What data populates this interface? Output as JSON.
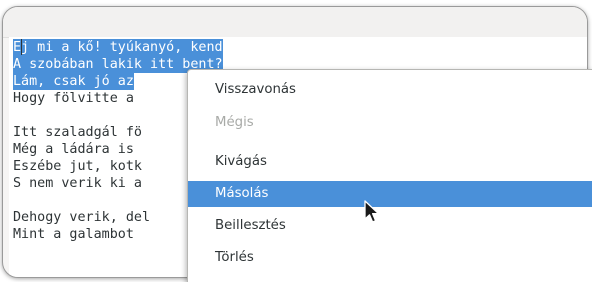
{
  "editor": {
    "lines": [
      {
        "text": "Ej mi a kő! tyúkanyó, kend",
        "selected": true
      },
      {
        "text": "A szobában lakik itt bent?",
        "selected": true
      },
      {
        "text": "Lám, csak jó az",
        "selected": true
      },
      {
        "text": "Hogy fölvitte a ",
        "selected": false
      },
      {
        "text": "",
        "selected": false
      },
      {
        "text": "Itt szaladgál fö",
        "selected": false
      },
      {
        "text": "Még a ládára is ",
        "selected": false
      },
      {
        "text": "Eszébe jut, kotk",
        "selected": false
      },
      {
        "text": "S nem verik ki a",
        "selected": false
      },
      {
        "text": "",
        "selected": false
      },
      {
        "text": "Dehogy verik, del",
        "selected": false
      },
      {
        "text": "Mint a galambot ",
        "selected": false
      }
    ]
  },
  "context_menu": {
    "items": [
      {
        "label": "Visszavonás",
        "state": "normal"
      },
      {
        "label": "Mégis",
        "state": "disabled"
      },
      {
        "label": "Kivágás",
        "state": "normal"
      },
      {
        "label": "Másolás",
        "state": "highlighted"
      },
      {
        "label": "Beillesztés",
        "state": "normal"
      },
      {
        "label": "Törlés",
        "state": "normal"
      }
    ]
  },
  "colors": {
    "selection": "#4a90d9",
    "text": "#2e3436",
    "disabled_text": "#a8aaa7"
  }
}
